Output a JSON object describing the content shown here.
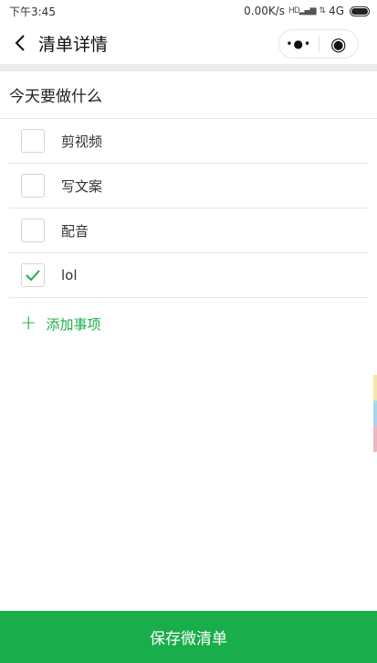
{
  "status_bar": {
    "time": "下午3:45",
    "network_speed": "0.00K/s",
    "signal_label": "HD",
    "network_type": "4G"
  },
  "navbar": {
    "title": "清单详情",
    "more_glyph": "•●•",
    "target_glyph": "◉"
  },
  "list": {
    "title": "今天要做什么",
    "items": [
      {
        "label": "剪视频",
        "checked": false
      },
      {
        "label": "写文案",
        "checked": false
      },
      {
        "label": "配音",
        "checked": false
      },
      {
        "label": "lol",
        "checked": true
      }
    ],
    "add_plus": "+",
    "add_label": "添加事项"
  },
  "footer": {
    "save_label": "保存微清单"
  },
  "colors": {
    "accent": "#1aad4b",
    "edge_marks": [
      "#f6e6a6",
      "#a9d6ef",
      "#efb6bf"
    ]
  }
}
